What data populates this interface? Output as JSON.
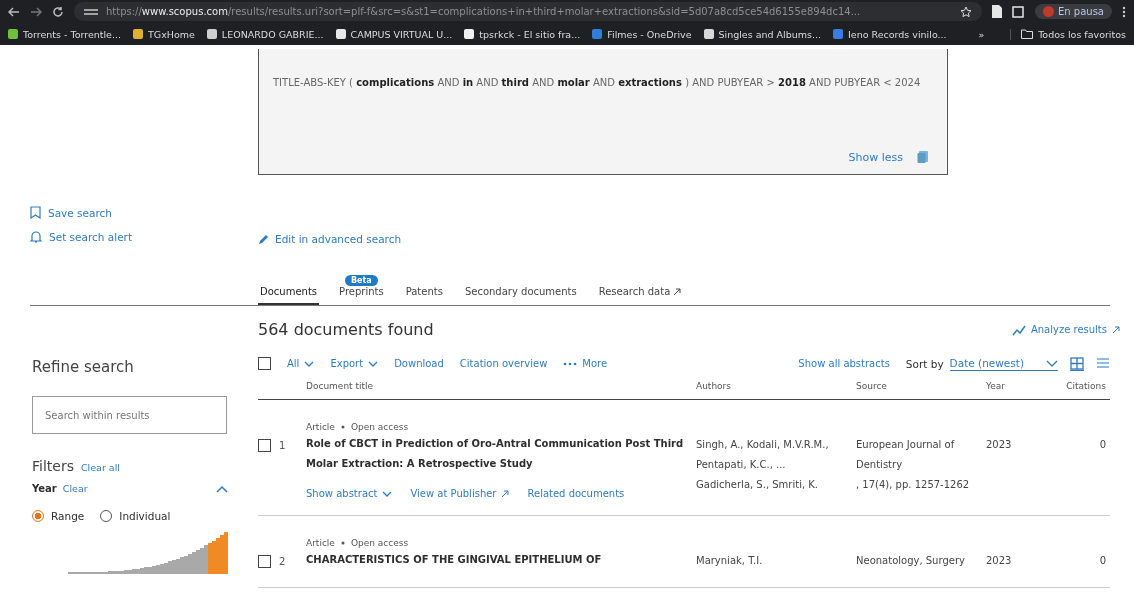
{
  "browser": {
    "url_prefix": "https://",
    "url_host": "www.scopus.com",
    "url_rest": "/results/results.uri?sort=plf-f&src=s&st1=complications+in+third+molar+extractions&sid=5d07a8cd5ce54d6155e894dc14...",
    "profile": "En pausa",
    "bookmarks": [
      {
        "label": "Torrents - Torrentle...",
        "color": "#6fbf3a"
      },
      {
        "label": "TGxHome",
        "color": "#e0b030"
      },
      {
        "label": "LEONARDO GABRIE...",
        "color": "#cfcfcf"
      },
      {
        "label": "CAMPUS VIRTUAL U...",
        "color": "#e8e8e8"
      },
      {
        "label": "tpsrkck - El sitio fra...",
        "color": "#f0f0f0"
      },
      {
        "label": "Filmes - OneDrive",
        "color": "#2f7fd6"
      },
      {
        "label": "Singles and Albums...",
        "color": "#d8d8d8"
      },
      {
        "label": "Ieno Records vinilo...",
        "color": "#3a7fe0"
      }
    ],
    "more": "»",
    "all_bookmarks": "Todos los favoritos"
  },
  "sidebar": {
    "actions": [
      {
        "kind": "bookmark",
        "label": "Save search"
      },
      {
        "kind": "bell",
        "label": "Set search alert"
      }
    ],
    "refine_title": "Refine search",
    "search_placeholder": "Search within results",
    "filters_title": "Filters",
    "clear_all": "Clear all",
    "year_title": "Year",
    "year_clear": "Clear",
    "year_expanded": true,
    "year_modes": [
      {
        "label": "Range",
        "selected": true
      },
      {
        "label": "Individual",
        "selected": false
      }
    ]
  },
  "query": {
    "text": "TITLE-ABS-KEY ( **complications** AND **in** AND **third** AND **molar** AND **extractions** ) AND PUBYEAR > **2018** AND PUBYEAR < 2024",
    "show_less": "Show less",
    "edit_link": "Edit in advanced search"
  },
  "tabs": [
    {
      "label": "Documents",
      "selected": true,
      "external": false
    },
    {
      "label": "Preprints",
      "selected": false,
      "badge": "Beta",
      "external": false
    },
    {
      "label": "Patents",
      "selected": false,
      "external": false
    },
    {
      "label": "Secondary documents",
      "selected": false,
      "external": false
    },
    {
      "label": "Research data",
      "selected": false,
      "external": true
    }
  ],
  "results": {
    "count": "564 documents found",
    "analyze": "Analyze results",
    "select_all_checked": false,
    "toolbar": [
      {
        "label": "All",
        "kind": "dropdown"
      },
      {
        "label": "Export",
        "kind": "dropdown"
      },
      {
        "label": "Download",
        "kind": "link"
      },
      {
        "label": "Citation overview",
        "kind": "link"
      },
      {
        "label": "More",
        "kind": "more"
      }
    ],
    "show_all_abstracts": "Show all abstracts",
    "sort_label": "Sort by",
    "sort_value": "Date (newest)",
    "views": [
      {
        "kind": "grid",
        "selected": true
      },
      {
        "kind": "list",
        "selected": false
      }
    ],
    "columns": [
      "Document title",
      "Authors",
      "Source",
      "Year",
      "Citations"
    ],
    "rows": [
      {
        "number": "1",
        "checked": false,
        "type": "Article",
        "access": "Open access",
        "title": "Role of CBCT in Prediction of Oro-Antral Communication Post Third Molar Extraction: A Retrospective Study",
        "authors": [
          "Singh, A., Kodali, M.V.R.M.,",
          "Pentapati, K.C., ...",
          "Gadicherla, S., Smriti, K."
        ],
        "source": [
          "European Journal of",
          "Dentistry",
          ", 17(4), pp. 1257-1262"
        ],
        "year": "2023",
        "citations": "0",
        "links": [
          "Show abstract",
          "View at Publisher",
          "Related documents"
        ]
      },
      {
        "number": "2",
        "checked": false,
        "type": "Article",
        "access": "Open access",
        "title": "CHARACTERISTICS OF THE GINGIVAL EPITHELIUM OF",
        "authors": [
          "Maryniak, T.I."
        ],
        "source": [
          "Neonatology, Surgery"
        ],
        "year": "2023",
        "citations": "0",
        "links": []
      }
    ]
  }
}
